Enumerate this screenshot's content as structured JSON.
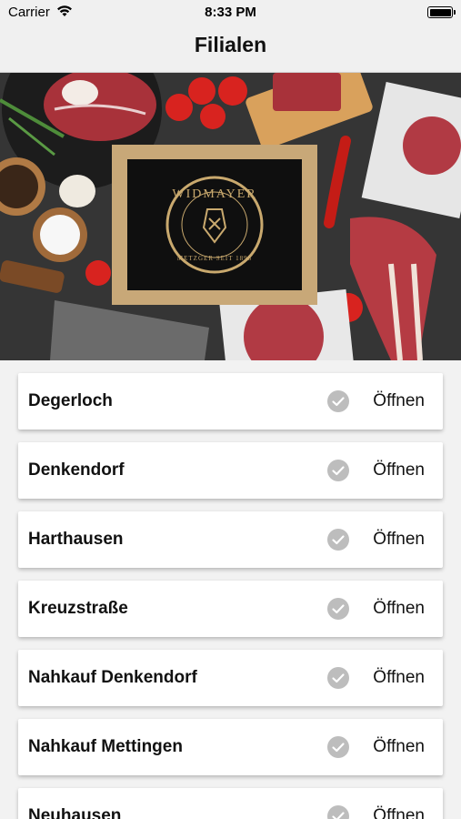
{
  "status_bar": {
    "carrier": "Carrier",
    "time": "8:33 PM"
  },
  "nav": {
    "title": "Filialen"
  },
  "hero": {
    "logo_text": "WIDMAYER",
    "logo_subtext": "METZGER SEIT 1895"
  },
  "branches": [
    {
      "name": "Degerloch",
      "status": "Öffnen"
    },
    {
      "name": "Denkendorf",
      "status": "Öffnen"
    },
    {
      "name": "Harthausen",
      "status": "Öffnen"
    },
    {
      "name": "Kreuzstraße",
      "status": "Öffnen"
    },
    {
      "name": "Nahkauf Denkendorf",
      "status": "Öffnen"
    },
    {
      "name": "Nahkauf Mettingen",
      "status": "Öffnen"
    },
    {
      "name": "Neuhausen",
      "status": "Öffnen"
    }
  ],
  "colors": {
    "check_circle": "#bdbdbd",
    "check_mark": "#ffffff",
    "nav_bg": "#f0f0f0",
    "board_frame": "#c8a878",
    "logo_gold": "#c9a96e"
  }
}
